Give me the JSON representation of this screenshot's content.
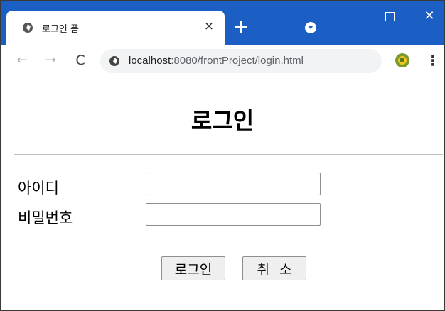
{
  "browser": {
    "tab": {
      "title": "로그인 폼",
      "close_glyph": "×",
      "icon": "globe-icon"
    },
    "new_tab_glyph": "+",
    "window_controls": {
      "close_glyph": "✕"
    },
    "nav": {
      "back_glyph": "←",
      "forward_glyph": "→",
      "reload_glyph": "C"
    },
    "address": {
      "host": "localhost",
      "path": ":8080/frontProject/login.html",
      "icon": "globe-icon"
    },
    "menu_glyph": "⋮",
    "extension_icon": "extension-icon"
  },
  "page": {
    "heading": "로그인",
    "fields": {
      "id_label": "아이디",
      "id_value": "",
      "pw_label": "비밀번호",
      "pw_value": ""
    },
    "buttons": {
      "login": "로그인",
      "cancel": "취소"
    }
  },
  "colors": {
    "titlebar": "#1c5fc4",
    "button_bg": "#efefef"
  }
}
